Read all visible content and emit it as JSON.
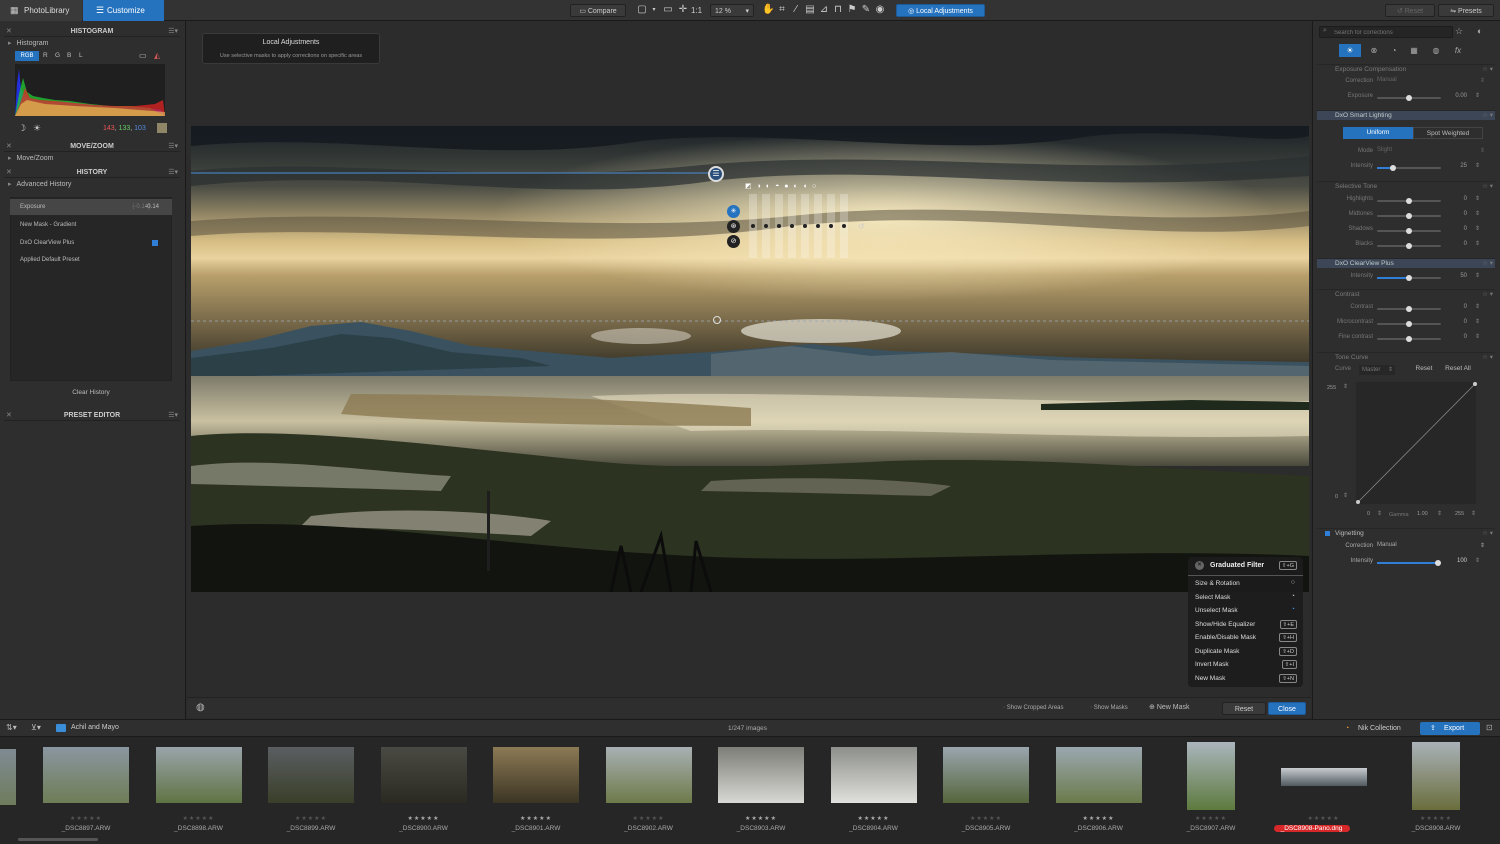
{
  "topbar": {
    "tab_library": "PhotoLibrary",
    "tab_customize": "Customize",
    "compare": "Compare",
    "zoom_fit": "1:1",
    "zoom_level": "12 %",
    "local_adjustments": "Local Adjustments",
    "reset": "Reset",
    "presets": "Presets"
  },
  "left": {
    "histogram_header": "HISTOGRAM",
    "histogram_label": "Histogram",
    "channels": [
      "RGB",
      "R",
      "G",
      "B",
      "L"
    ],
    "rgb_values": {
      "r": "143",
      "g": "133",
      "b": "103"
    },
    "movezoom_header": "MOVE/ZOOM",
    "movezoom_label": "Move/Zoom",
    "history_header": "HISTORY",
    "history_label": "Advanced History",
    "history_items": [
      {
        "label": "Exposure",
        "extra": "(-0.14)",
        "value": "-0.14"
      },
      {
        "label": "New Mask - Gradient"
      },
      {
        "label": "DxO ClearView Plus"
      },
      {
        "label": "Applied Default Preset"
      }
    ],
    "clear_history": "Clear History",
    "preset_header": "PRESET EDITOR"
  },
  "tooltip": {
    "title": "Local Adjustments",
    "text": "Use selective masks to apply corrections on specific areas"
  },
  "context_menu": {
    "title": "Graduated Filter",
    "title_key": "⇧+G",
    "items": [
      {
        "label": "Size & Rotation",
        "key": ""
      },
      {
        "label": "Select Mask",
        "key": ""
      },
      {
        "label": "Unselect Mask",
        "key": ""
      },
      {
        "label": "Show/Hide Equalizer",
        "key": "⇧+E"
      },
      {
        "label": "Enable/Disable Mask",
        "key": "⇧+H"
      },
      {
        "label": "Duplicate Mask",
        "key": "⇧+D"
      },
      {
        "label": "Invert Mask",
        "key": "⇧+I"
      },
      {
        "label": "New Mask",
        "key": "⇧+N"
      }
    ]
  },
  "bottom_bar": {
    "show_cropped": "Show Cropped Areas",
    "show_masks": "Show Masks",
    "new_mask": "New Mask",
    "reset": "Reset",
    "close": "Close"
  },
  "right": {
    "search_placeholder": "Search for corrections",
    "exposure_comp": "Exposure Compensation",
    "correction_label": "Correction",
    "correction_value": "Manual",
    "exposure_label": "Exposure",
    "exposure_value": "0.00",
    "exposure_level": 0.5,
    "smart_lighting": "DxO Smart Lighting",
    "uniform": "Uniform",
    "spot_weighted": "Spot Weighted",
    "mode_label": "Mode",
    "mode_value": "Slight",
    "intensity_label": "Intensity",
    "sl_intensity": "25",
    "sl_level": 0.25,
    "selective_tone": "Selective Tone",
    "tones": [
      {
        "label": "Highlights",
        "value": "0"
      },
      {
        "label": "Midtones",
        "value": "0"
      },
      {
        "label": "Shadows",
        "value": "0"
      },
      {
        "label": "Blacks",
        "value": "0"
      }
    ],
    "clearview": "DxO ClearView Plus",
    "cv_intensity": "50",
    "cv_level": 0.5,
    "contrast_header": "Contrast",
    "contrasts": [
      {
        "label": "Contrast",
        "value": "0"
      },
      {
        "label": "Microcontrast",
        "value": "0"
      },
      {
        "label": "Fine contrast",
        "value": "0"
      }
    ],
    "tone_curve": "Tone Curve",
    "curve_label": "Curve",
    "curve_value": "Master",
    "tc_reset": "Reset",
    "tc_reset_all": "Reset All",
    "tc_max": "255",
    "tc_min": "0",
    "tc_in_min": "0",
    "gamma_label": "Gamma",
    "gamma_value": "1.00",
    "tc_in_max": "255",
    "vignetting": "Vignetting",
    "vig_correction": "Manual",
    "vig_intensity": "100",
    "vig_level": 0.95
  },
  "filmbar": {
    "folder": "Achil and Mayo",
    "count": "1/247 images",
    "nik": "Nik Collection",
    "export": "Export"
  },
  "thumbnails": [
    {
      "name": "_DSC8897.ARW",
      "rated": false
    },
    {
      "name": "_DSC8898.ARW",
      "rated": false
    },
    {
      "name": "_DSC8899.ARW",
      "rated": false
    },
    {
      "name": "_DSC8900.ARW",
      "rated": true
    },
    {
      "name": "_DSC8901.ARW",
      "rated": true
    },
    {
      "name": "_DSC8902.ARW",
      "rated": false
    },
    {
      "name": "_DSC8903.ARW",
      "rated": true
    },
    {
      "name": "_DSC8904.ARW",
      "rated": true
    },
    {
      "name": "_DSC8905.ARW",
      "rated": false
    },
    {
      "name": "_DSC8906.ARW",
      "rated": true
    },
    {
      "name": "_DSC8907.ARW",
      "rated": false
    },
    {
      "name": "_DSC8908-Pano.dng",
      "rated": false
    },
    {
      "name": "_DSC8908.ARW",
      "rated": false
    }
  ],
  "colors": {
    "accent": "#2f7fd8",
    "highlight_name": "#d62828"
  }
}
